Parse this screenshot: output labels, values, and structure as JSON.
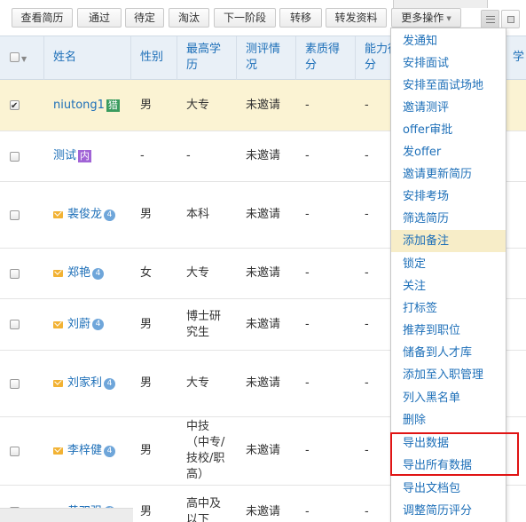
{
  "toolbar": {
    "buttons": [
      "查看简历",
      "通过",
      "待定",
      "淘汰",
      "下一阶段",
      "转移",
      "转发资料",
      "更多操作"
    ]
  },
  "table": {
    "headers": [
      "姓名",
      "性别",
      "最高学历",
      "测评情况",
      "素质得分",
      "能力得分",
      "学"
    ],
    "rows": [
      {
        "name": "niutong1",
        "tag": "猎",
        "gender": "男",
        "education": "大专",
        "assessment": "未邀请",
        "quality": "-",
        "ability": "-",
        "checked": true
      },
      {
        "name": "测试",
        "tag": "内",
        "gender": "-",
        "education": "-",
        "assessment": "未邀请",
        "quality": "-",
        "ability": "-",
        "checked": false
      },
      {
        "name": "裴俊龙",
        "badge": "4",
        "gender": "男",
        "education": "本科",
        "assessment": "未邀请",
        "quality": "-",
        "ability": "-",
        "checked": false
      },
      {
        "name": "郑艳",
        "badge": "4",
        "gender": "女",
        "education": "大专",
        "assessment": "未邀请",
        "quality": "-",
        "ability": "-",
        "checked": false
      },
      {
        "name": "刘蔚",
        "badge": "4",
        "gender": "男",
        "education": "博士研究生",
        "assessment": "未邀请",
        "quality": "-",
        "ability": "-",
        "checked": false
      },
      {
        "name": "刘家利",
        "badge": "4",
        "gender": "男",
        "education": "大专",
        "assessment": "未邀请",
        "quality": "-",
        "ability": "-",
        "checked": false
      },
      {
        "name": "李梓健",
        "badge": "4",
        "gender": "男",
        "education": "中技（中专/技校/职高）",
        "assessment": "未邀请",
        "quality": "-",
        "ability": "-",
        "checked": false
      },
      {
        "name": "黄双强",
        "badge": "4",
        "gender": "男",
        "education": "高中及以下",
        "assessment": "未邀请",
        "quality": "-",
        "ability": "-",
        "checked": false
      }
    ]
  },
  "menu": {
    "items": [
      "发通知",
      "安排面试",
      "安排至面试场地",
      "邀请测评",
      "offer审批",
      "发offer",
      "邀请更新简历",
      "安排考场",
      "筛选简历",
      "添加备注",
      "锁定",
      "关注",
      "打标签",
      "推荐到职位",
      "储备到人才库",
      "添加至入职管理",
      "列入黑名单",
      "删除",
      "导出数据",
      "导出所有数据",
      "导出文档包",
      "调整简历评分"
    ],
    "hovered": "添加备注",
    "boxed": [
      "导出数据",
      "导出所有数据"
    ]
  },
  "colors": {
    "link": "#1d6fb8",
    "header_bg": "#e9f0f7",
    "selected_row": "#fbf3d3",
    "menu_hover": "#f7edc8",
    "highlight_border": "#e01414",
    "tag_green": "#3a9b5f",
    "tag_purple": "#a164d6",
    "badge_blue": "#6fa6da",
    "mail_icon": "#f2b233"
  }
}
